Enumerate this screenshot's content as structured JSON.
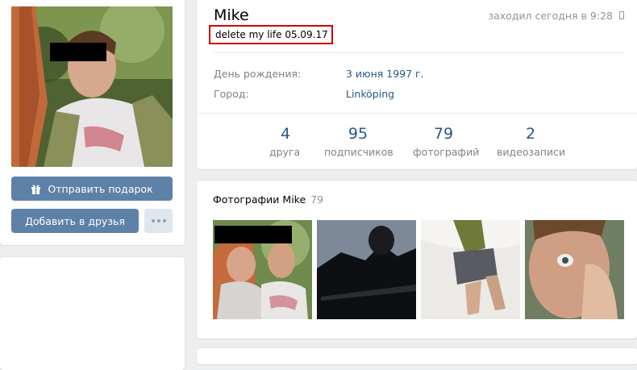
{
  "profile": {
    "name": "Mike",
    "online": "заходил сегодня в 9:28",
    "status": "delete my life 05.09.17",
    "fields": [
      {
        "label": "День рождения:",
        "value": "3 июня 1997 г."
      },
      {
        "label": "Город:",
        "value": "Linköping"
      }
    ],
    "counters": [
      {
        "num": "4",
        "label": "друга"
      },
      {
        "num": "95",
        "label": "подписчиков"
      },
      {
        "num": "79",
        "label": "фотографий"
      },
      {
        "num": "2",
        "label": "видеозаписи"
      }
    ]
  },
  "actions": {
    "gift_label": "Отправить подарок",
    "add_friend_label": "Добавить в друзья",
    "more_icon": "ellipsis-icon",
    "gift_icon": "gift-icon"
  },
  "photos": {
    "title": "Фотографии Mike",
    "count": "79"
  },
  "colors": {
    "accent": "#5e81a8",
    "link": "#2a5885",
    "status_highlight": "#d20000",
    "background": "#edeef0"
  }
}
